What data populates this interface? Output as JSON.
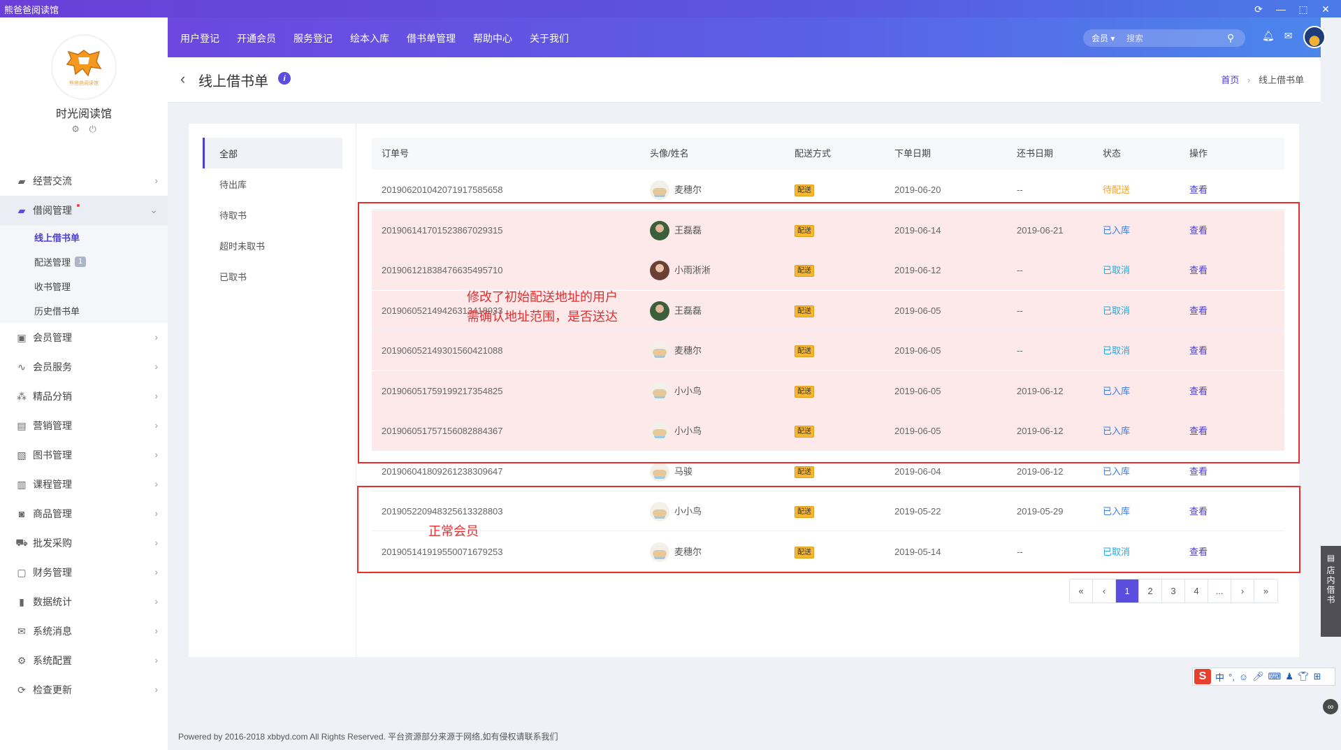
{
  "app": {
    "window_title": "熊爸爸阅读馆"
  },
  "store": {
    "name": "时光阅读馆",
    "logo_text": "熊爸爸阅读馆"
  },
  "menu": {
    "items": [
      {
        "label": "经营交流",
        "icon": "chat-icon"
      },
      {
        "label": "借阅管理",
        "icon": "book-icon",
        "active": true
      },
      {
        "label": "会员管理",
        "icon": "member-icon"
      },
      {
        "label": "会员服务",
        "icon": "service-icon"
      },
      {
        "label": "精品分销",
        "icon": "distribution-icon"
      },
      {
        "label": "营销管理",
        "icon": "marketing-icon"
      },
      {
        "label": "图书管理",
        "icon": "library-icon"
      },
      {
        "label": "课程管理",
        "icon": "course-icon"
      },
      {
        "label": "商品管理",
        "icon": "goods-icon"
      },
      {
        "label": "批发采购",
        "icon": "cart-icon"
      },
      {
        "label": "财务管理",
        "icon": "finance-icon"
      },
      {
        "label": "数据统计",
        "icon": "chart-icon"
      },
      {
        "label": "系统消息",
        "icon": "mail-icon"
      },
      {
        "label": "系统配置",
        "icon": "gear-icon"
      },
      {
        "label": "检查更新",
        "icon": "refresh-icon"
      }
    ],
    "submenu": [
      {
        "label": "线上借书单"
      },
      {
        "label": "配送管理",
        "badge": "1"
      },
      {
        "label": "收书管理"
      },
      {
        "label": "历史借书单"
      }
    ]
  },
  "topnav": {
    "links": [
      "用户登记",
      "开通会员",
      "服务登记",
      "绘本入库",
      "借书单管理",
      "帮助中心",
      "关于我们"
    ],
    "search_select": "会员",
    "search_placeholder": "搜索"
  },
  "page": {
    "title": "线上借书单",
    "breadcrumb_home": "首页",
    "breadcrumb_current": "线上借书单"
  },
  "tabs": [
    "全部",
    "待出库",
    "待取书",
    "超时未取书",
    "已取书"
  ],
  "table": {
    "headers": [
      "订单号",
      "头像/姓名",
      "配送方式",
      "下单日期",
      "还书日期",
      "状态",
      "操作"
    ],
    "rows": [
      {
        "order": "20190620104207191758565​8",
        "name": "麦穗尔",
        "ship": "配送",
        "date": "2019-06-20",
        "ret": "--",
        "status": "待配送",
        "op": "查看"
      },
      {
        "order": "20190614170152386702931​5",
        "name": "王磊磊",
        "ship": "配送",
        "date": "2019-06-14",
        "ret": "2019-06-21",
        "status": "已入库",
        "op": "查看"
      },
      {
        "order": "20190612183847663549571​0",
        "name": "小雨淅淅",
        "ship": "配送",
        "date": "2019-06-12",
        "ret": "--",
        "status": "已取消",
        "op": "查看"
      },
      {
        "order": "20190605214942631341893​3",
        "name": "王磊磊",
        "ship": "配送",
        "date": "2019-06-05",
        "ret": "--",
        "status": "已取消",
        "op": "查看"
      },
      {
        "order": "20190605214930156042108​8",
        "name": "麦穗尔",
        "ship": "配送",
        "date": "2019-06-05",
        "ret": "--",
        "status": "已取消",
        "op": "查看"
      },
      {
        "order": "20190605175919921735482​5",
        "name": "小小鸟",
        "ship": "配送",
        "date": "2019-06-05",
        "ret": "2019-06-12",
        "status": "已入库",
        "op": "查看"
      },
      {
        "order": "20190605175715608288436​7",
        "name": "小小鸟",
        "ship": "配送",
        "date": "2019-06-05",
        "ret": "2019-06-12",
        "status": "已入库",
        "op": "查看"
      },
      {
        "order": "20190604180926123830964​7",
        "name": "马骏",
        "ship": "配送",
        "date": "2019-06-04",
        "ret": "2019-06-12",
        "status": "已入库",
        "op": "查看"
      },
      {
        "order": "20190522094832561332880​3",
        "name": "小小鸟",
        "ship": "配送",
        "date": "2019-05-22",
        "ret": "2019-05-29",
        "status": "已入库",
        "op": "查看"
      },
      {
        "order": "20190514191955007167925​3",
        "name": "麦穗尔",
        "ship": "配送",
        "date": "2019-05-14",
        "ret": "--",
        "status": "已取消",
        "op": "查看"
      }
    ]
  },
  "pager": [
    "«",
    "‹",
    "1",
    "2",
    "3",
    "4",
    "...",
    "›",
    "»"
  ],
  "annotations": {
    "note1_line1": "修改了初始配送地址的用户",
    "note1_line2": "需确认地址范围，是否送达",
    "note2": "正常会员"
  },
  "footer": "Powered by 2016-2018 xbbyd.com All Rights Reserved. 平台资源部分来源于网络,如有侵权请联系我们",
  "side_float": "店内借书",
  "colors": {
    "accent": "#5b4de0",
    "highlight": "#fde9ea",
    "annotation": "#e62e2e"
  }
}
